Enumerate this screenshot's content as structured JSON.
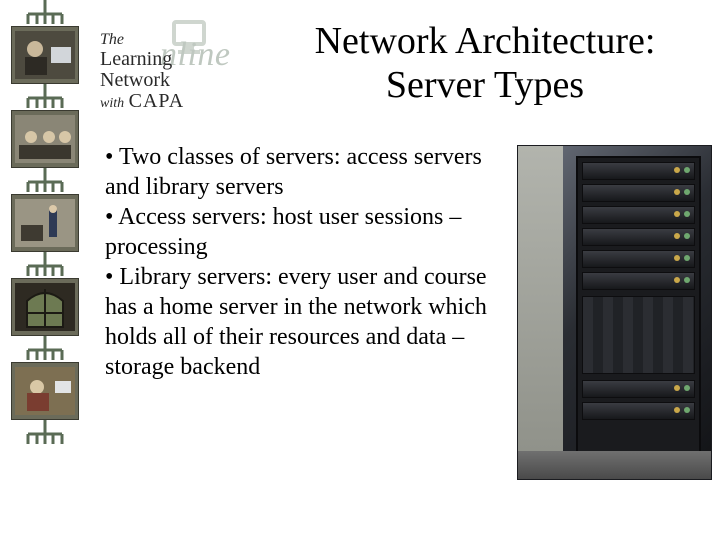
{
  "logo": {
    "the": "The",
    "learning": "Learning",
    "network": "Network",
    "with": "with",
    "capa": "CAPA",
    "bg_word": "nline"
  },
  "title": {
    "line1": "Network Architecture:",
    "line2": "Server Types"
  },
  "bullets": [
    "• Two classes of servers: access servers and library servers",
    "• Access servers: host user sessions – processing",
    "• Library servers: every user and course has a home server in the network which holds all of their resources and data – storage backend"
  ],
  "sidebar": {
    "thumbs": [
      "photo-person-computer",
      "photo-classroom",
      "photo-presenter",
      "photo-arched-window",
      "photo-students"
    ]
  },
  "server_photo_label": "server-rack-photo"
}
